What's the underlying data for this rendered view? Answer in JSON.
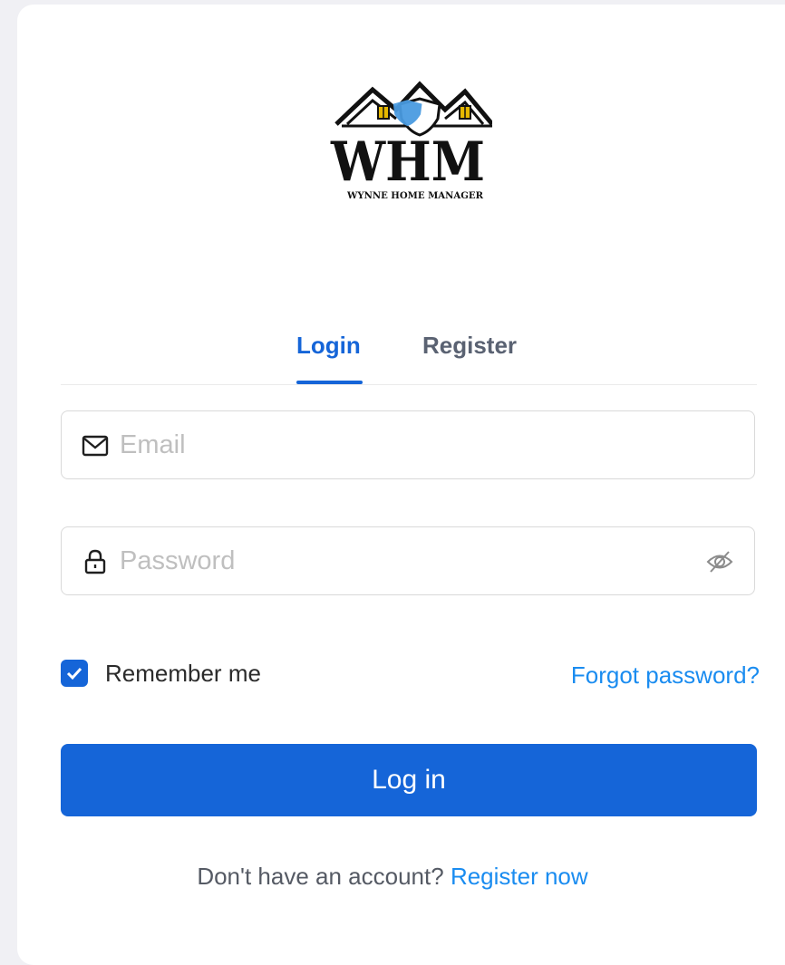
{
  "brand": {
    "logo_text": "WHM",
    "logo_subtitle": "WYNNE HOME MANAGER"
  },
  "tabs": [
    {
      "label": "Login",
      "active": true
    },
    {
      "label": "Register",
      "active": false
    }
  ],
  "form": {
    "email": {
      "placeholder": "Email",
      "value": "",
      "icon": "mail-icon"
    },
    "password": {
      "placeholder": "Password",
      "value": "",
      "icon": "lock-icon",
      "toggle_icon": "eye-off-icon"
    },
    "remember_label": "Remember me",
    "remember_checked": true,
    "forgot_label": "Forgot password?",
    "submit_label": "Log in"
  },
  "footer": {
    "prompt": "Don't have an account?",
    "link_label": "Register now"
  },
  "colors": {
    "primary": "#1565d8",
    "link": "#1a8cf0",
    "background": "#f0f0f4"
  }
}
